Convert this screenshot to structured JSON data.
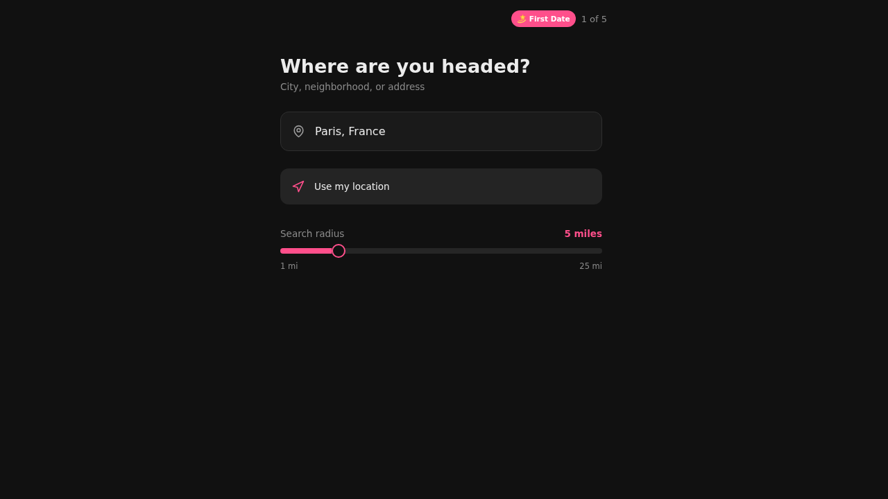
{
  "header": {
    "badge": {
      "label": "First Date"
    },
    "step": "1 of 5"
  },
  "title": "Where are you headed?",
  "subtitle": "City, neighborhood, or address",
  "location_field": {
    "value": "Paris, France"
  },
  "location_button": {
    "label": "Use my location"
  },
  "radius": {
    "label": "Search radius",
    "reading": "5 miles",
    "level": 0.18,
    "min_label": "1 mi",
    "max_label": "25 mi"
  }
}
